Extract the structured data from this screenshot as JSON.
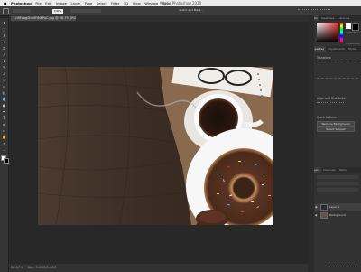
{
  "menubar": {
    "apple": "",
    "app": "Photoshop",
    "items": [
      "File",
      "Edit",
      "Image",
      "Layer",
      "Type",
      "Select",
      "Filter",
      "3D",
      "View",
      "Window",
      "Help"
    ]
  },
  "window": {
    "title": "Adobe Photoshop 2020"
  },
  "document": {
    "tab": "7-hflFsqg0hbVF6lKPAC.jpg @ 66.7% (RGB/8)"
  },
  "options_bar": {
    "zoom_field": "100%",
    "search_label": "Select and Mask..."
  },
  "status_bar": {
    "zoom": "66.67%",
    "info": "Doc: 5.49M/5.49M"
  },
  "panels": {
    "top_tabs": [
      "Color",
      "Swatches",
      "Libraries"
    ],
    "properties_tabs": [
      "Properties",
      "Adjustments",
      "Styles"
    ],
    "properties_section": "Transform",
    "align_label": "Align and Distribute",
    "quick_actions_label": "Quick Actions",
    "buttons": [
      "Remove Background",
      "Select Subject"
    ],
    "layers_tabs": [
      "Layers",
      "Channels",
      "Paths"
    ],
    "layers": [
      {
        "name": "Layer 1"
      },
      {
        "name": "Background"
      }
    ]
  },
  "colors": {
    "fg": "#ffffff",
    "bg": "#000000",
    "accent": "#1473e6",
    "wood": "#3a2c23"
  },
  "icons": [
    "apple-icon",
    "move-tool-icon",
    "marquee-tool-icon",
    "lasso-tool-icon",
    "crop-tool-icon",
    "brush-tool-icon",
    "eraser-tool-icon",
    "gradient-tool-icon",
    "pen-tool-icon",
    "type-tool-icon",
    "hand-tool-icon",
    "zoom-tool-icon",
    "eye-icon"
  ]
}
